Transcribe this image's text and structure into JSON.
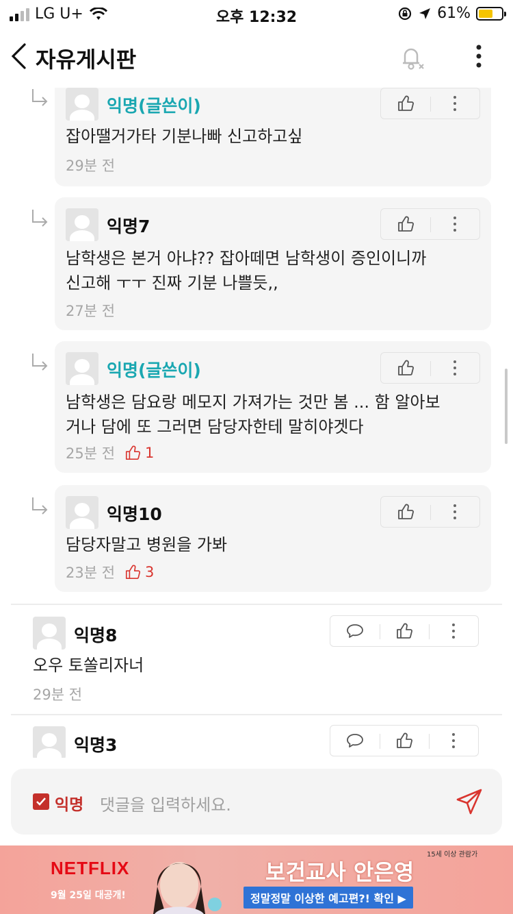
{
  "status_bar": {
    "carrier": "LG U+",
    "time": "오후 12:32",
    "battery": "61%",
    "battery_level": 0.61
  },
  "nav": {
    "title": "자유게시판"
  },
  "replies": [
    {
      "author": "익명(글쓴이)",
      "is_writer": true,
      "lines": [
        "잡아땔거가타 기분나빠 신고하고싶"
      ],
      "time": "29분 전",
      "likes": ""
    },
    {
      "author": "익명7",
      "is_writer": false,
      "lines": [
        "남학생은 본거 아냐?? 잡아떼면 남학생이 증인이니까",
        "신고해 ㅜㅜ 진짜 기분 나쁠듯,,"
      ],
      "time": "27분 전",
      "likes": ""
    },
    {
      "author": "익명(글쓴이)",
      "is_writer": true,
      "lines": [
        "남학생은 담요랑 메모지 가져가는 것만 봄 ... 함 알아보",
        "거나 담에 또 그러면 담당자한테 말히야겟다"
      ],
      "time": "25분 전",
      "likes": "1"
    },
    {
      "author": "익명10",
      "is_writer": false,
      "lines": [
        "담당자말고 병원을 가봐"
      ],
      "time": "23분 전",
      "likes": "3"
    }
  ],
  "comments": [
    {
      "author": "익명8",
      "text": "오우 토쏠리자너",
      "time": "29분 전"
    },
    {
      "author": "익명3",
      "text": "",
      "time": ""
    }
  ],
  "input": {
    "anon_label": "익명",
    "placeholder": "댓글을 입력하세요."
  },
  "ad": {
    "brand": "NETFLIX",
    "date": "9월 25일 대공개!",
    "title": "보건교사 안은영",
    "cta": "정말정말 이상한 예고편?! 확인 ▶",
    "rating": "15세 이상 관람가"
  },
  "colors": {
    "writer": "#1aa7b1",
    "like_active": "#d9352f",
    "accent": "#c4302b"
  }
}
